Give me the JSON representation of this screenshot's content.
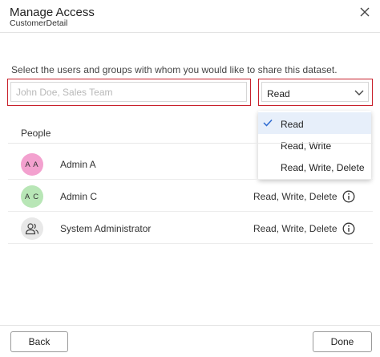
{
  "dialog": {
    "title": "Manage Access",
    "subtitle": "CustomerDetail"
  },
  "share": {
    "instruction": "Select the users and groups with whom you would like to share this dataset.",
    "input": {
      "value": "",
      "placeholder": "John Doe, Sales Team"
    },
    "permission": {
      "selected": "Read",
      "options": [
        "Read",
        "Read, Write",
        "Read, Write, Delete"
      ]
    }
  },
  "table": {
    "header": "People",
    "rows": [
      {
        "initials": "A A",
        "name": "Admin A",
        "permission": "",
        "avatar_color": "#f3a1cf",
        "icon": ""
      },
      {
        "initials": "A C",
        "name": "Admin C",
        "permission": "Read, Write, Delete",
        "avatar_color": "#b8e6b6",
        "icon": ""
      },
      {
        "initials": "",
        "name": "System Administrator",
        "permission": "Read, Write, Delete",
        "avatar_color": "#e8e8e8",
        "icon": "group-icon"
      }
    ]
  },
  "footer": {
    "back_label": "Back",
    "done_label": "Done"
  },
  "colors": {
    "accent_red": "#c8202b",
    "selected_bg": "#e7effa",
    "check_blue": "#2e6bd1"
  }
}
